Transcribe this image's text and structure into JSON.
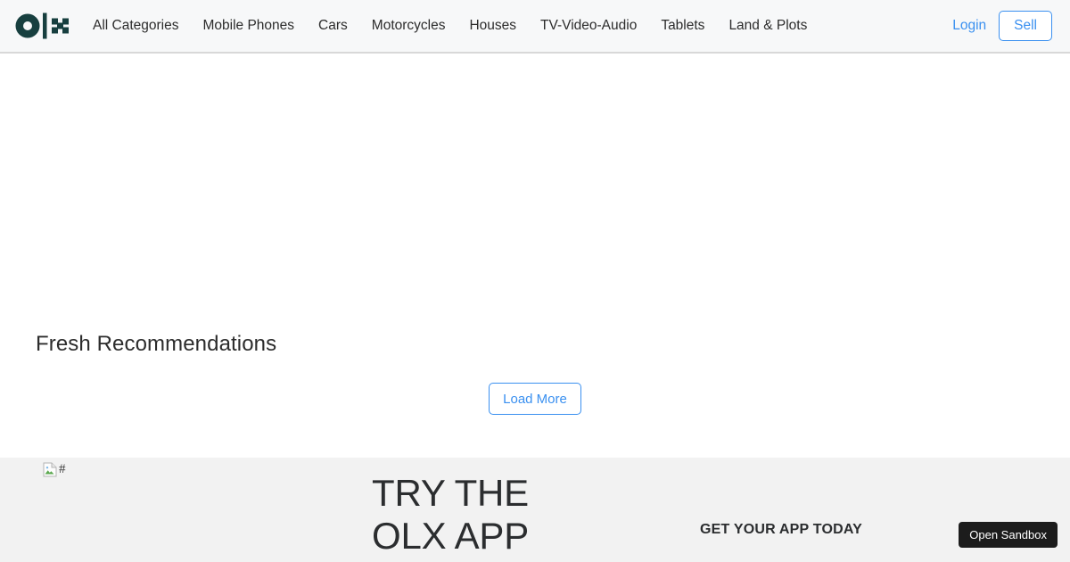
{
  "header": {
    "logo": {
      "icon_name": "olx-logo",
      "text": "olx",
      "color": "#173f3f"
    },
    "nav_items": [
      {
        "label": "All Categories"
      },
      {
        "label": "Mobile Phones"
      },
      {
        "label": "Cars"
      },
      {
        "label": "Motorcycles"
      },
      {
        "label": "Houses"
      },
      {
        "label": "TV-Video-Audio"
      },
      {
        "label": "Tablets"
      },
      {
        "label": "Land & Plots"
      }
    ],
    "login_label": "Login",
    "sell_label": "Sell",
    "accent_color": "#3a90f0",
    "background_color": "#f7f8f9"
  },
  "main": {
    "section_title": "Fresh Recommendations",
    "load_more_label": "Load More",
    "listings": []
  },
  "app_banner": {
    "image_alt": "#",
    "image_icon_name": "broken-image-icon",
    "headline": "TRY THE OLX APP",
    "cta_text": "GET YOUR APP TODAY",
    "background_color": "#f2f2f2"
  },
  "overlay": {
    "open_sandbox_label": "Open Sandbox"
  }
}
